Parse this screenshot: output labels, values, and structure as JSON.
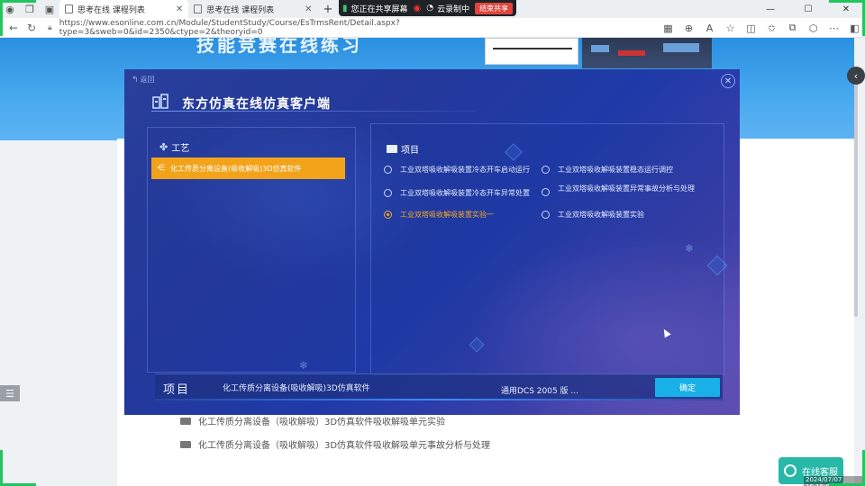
{
  "browser": {
    "tabs": [
      {
        "label": "思考在线 课程列表",
        "active": true
      },
      {
        "label": "思考在线 课程列表",
        "active": false
      }
    ],
    "share_banner": {
      "screen_share": "您正在共享屏幕",
      "recording": "云录制中",
      "stop": "结束共享"
    },
    "url": "https://www.esonline.com.cn/Module/StudentStudy/Course/EsTrmsRent/Detail.aspx?type=3&sweb=0&id=2350&ctype=2&theoryid=0"
  },
  "page": {
    "banner_title": "技能竞赛在线练习",
    "list_items": [
      "化工传质分离设备（吸收解吸）3D仿真软件吸收解吸单元实验",
      "化工传质分离设备（吸收解吸）3D仿真软件吸收解吸单元事故分析与处理"
    ],
    "consult_label": "在线客服",
    "timestamp": "2024/07/07 15:15:03"
  },
  "dialog": {
    "back_label": "返回",
    "title": "东方仿真在线仿真客户端",
    "process": {
      "header": "工艺",
      "items": [
        "化工传质分离设备(吸收解吸)3D仿真软件"
      ]
    },
    "project": {
      "header": "项目",
      "options": [
        {
          "label": "工业双塔吸收解吸装置冷态开车启动运行",
          "selected": false
        },
        {
          "label": "工业双塔吸收解吸装置稳态运行调控",
          "selected": false
        },
        {
          "label": "工业双塔吸收解吸装置冷态开车异常处置",
          "selected": false
        },
        {
          "label": "工业双塔吸收解吸装置异常事故分析与处理",
          "selected": false
        },
        {
          "label": "工业双塔吸收解吸装置实验一",
          "selected": true
        },
        {
          "label": "工业双塔吸收解吸装置实验",
          "selected": false
        }
      ]
    },
    "footer": {
      "label": "项目",
      "name": "化工传质分离设备(吸收解吸)3D仿真软件",
      "version": "通用DCS 2005 版 ...",
      "confirm": "确定"
    }
  },
  "colors": {
    "accent_orange": "#f2a31a",
    "confirm_blue": "#19b0e8",
    "dialog_blue": "#24399a"
  }
}
